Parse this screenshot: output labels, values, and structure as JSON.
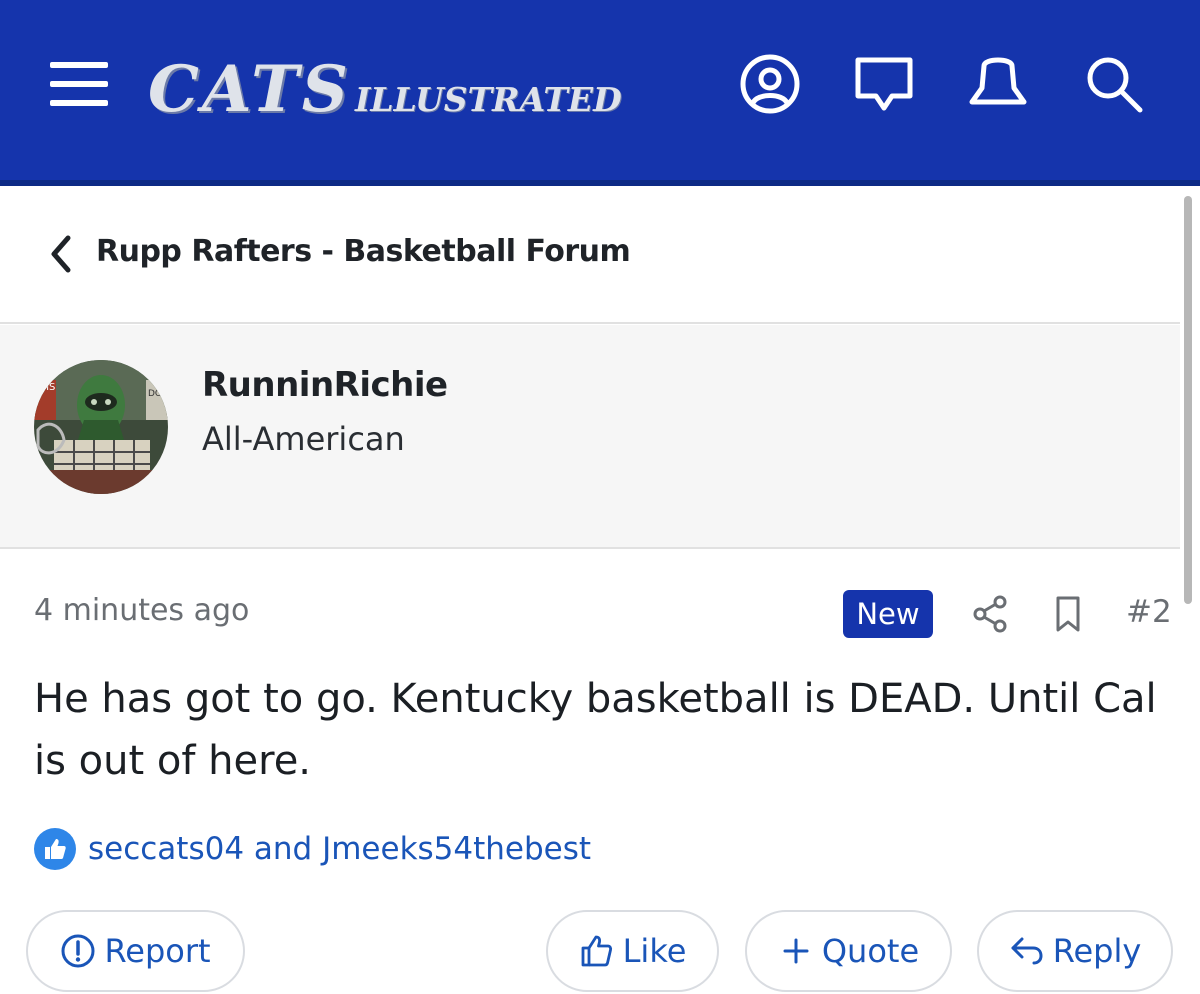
{
  "header": {
    "logo_main": "CATS",
    "logo_sub": "ILLUSTRATED",
    "bg_color": "#1534ac",
    "icons": [
      "menu-icon",
      "account-icon",
      "messages-icon",
      "alerts-icon",
      "search-icon"
    ]
  },
  "breadcrumb": {
    "label": "Rupp Rafters - Basketball Forum"
  },
  "user": {
    "name": "RunninRichie",
    "title": "All-American"
  },
  "post": {
    "time": "4 minutes ago",
    "badge": "New",
    "number": "#2",
    "body": "He has got to go. Kentucky basketball is DEAD. Until Cal is out of here.",
    "likes": "seccats04 and Jmeeks54thebest"
  },
  "actions": {
    "report": "Report",
    "like": "Like",
    "quote": "Quote",
    "reply": "Reply"
  },
  "colors": {
    "accent": "#1534ac",
    "link": "#1a55b8",
    "like_badge": "#2e86e8"
  }
}
